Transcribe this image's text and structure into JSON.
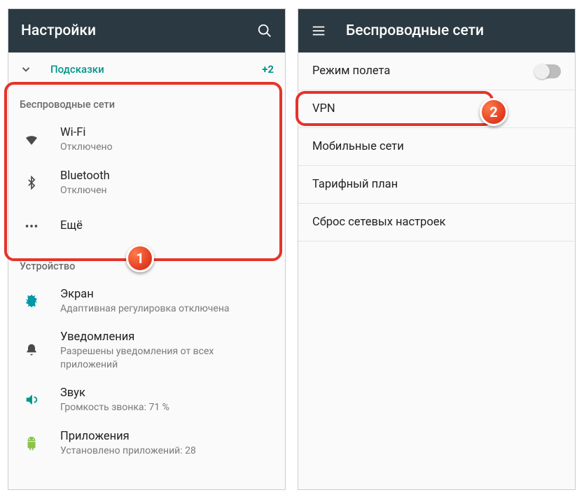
{
  "left": {
    "title": "Настройки",
    "suggest": {
      "label": "Подсказки",
      "count": "+2"
    },
    "section_wireless": "Беспроводные сети",
    "section_device": "Устройство",
    "wifi": {
      "title": "Wi-Fi",
      "sub": "Отключено"
    },
    "bt": {
      "title": "Bluetooth",
      "sub": "Отключен"
    },
    "more": {
      "title": "Ещё"
    },
    "display": {
      "title": "Экран",
      "sub": "Адаптивная регулировка отключена"
    },
    "notif": {
      "title": "Уведомления",
      "sub": "Разрешены уведомления от всех приложений"
    },
    "sound": {
      "title": "Звук",
      "sub": "Громкость звонка: 71 %"
    },
    "apps": {
      "title": "Приложения",
      "sub": "Установлено приложений: 28"
    }
  },
  "right": {
    "title": "Беспроводные сети",
    "items": {
      "airplane": "Режим полета",
      "vpn": "VPN",
      "mobile": "Мобильные сети",
      "plan": "Тарифный план",
      "reset": "Сброс сетевых настроек"
    }
  },
  "badges": {
    "b1": "1",
    "b2": "2"
  }
}
